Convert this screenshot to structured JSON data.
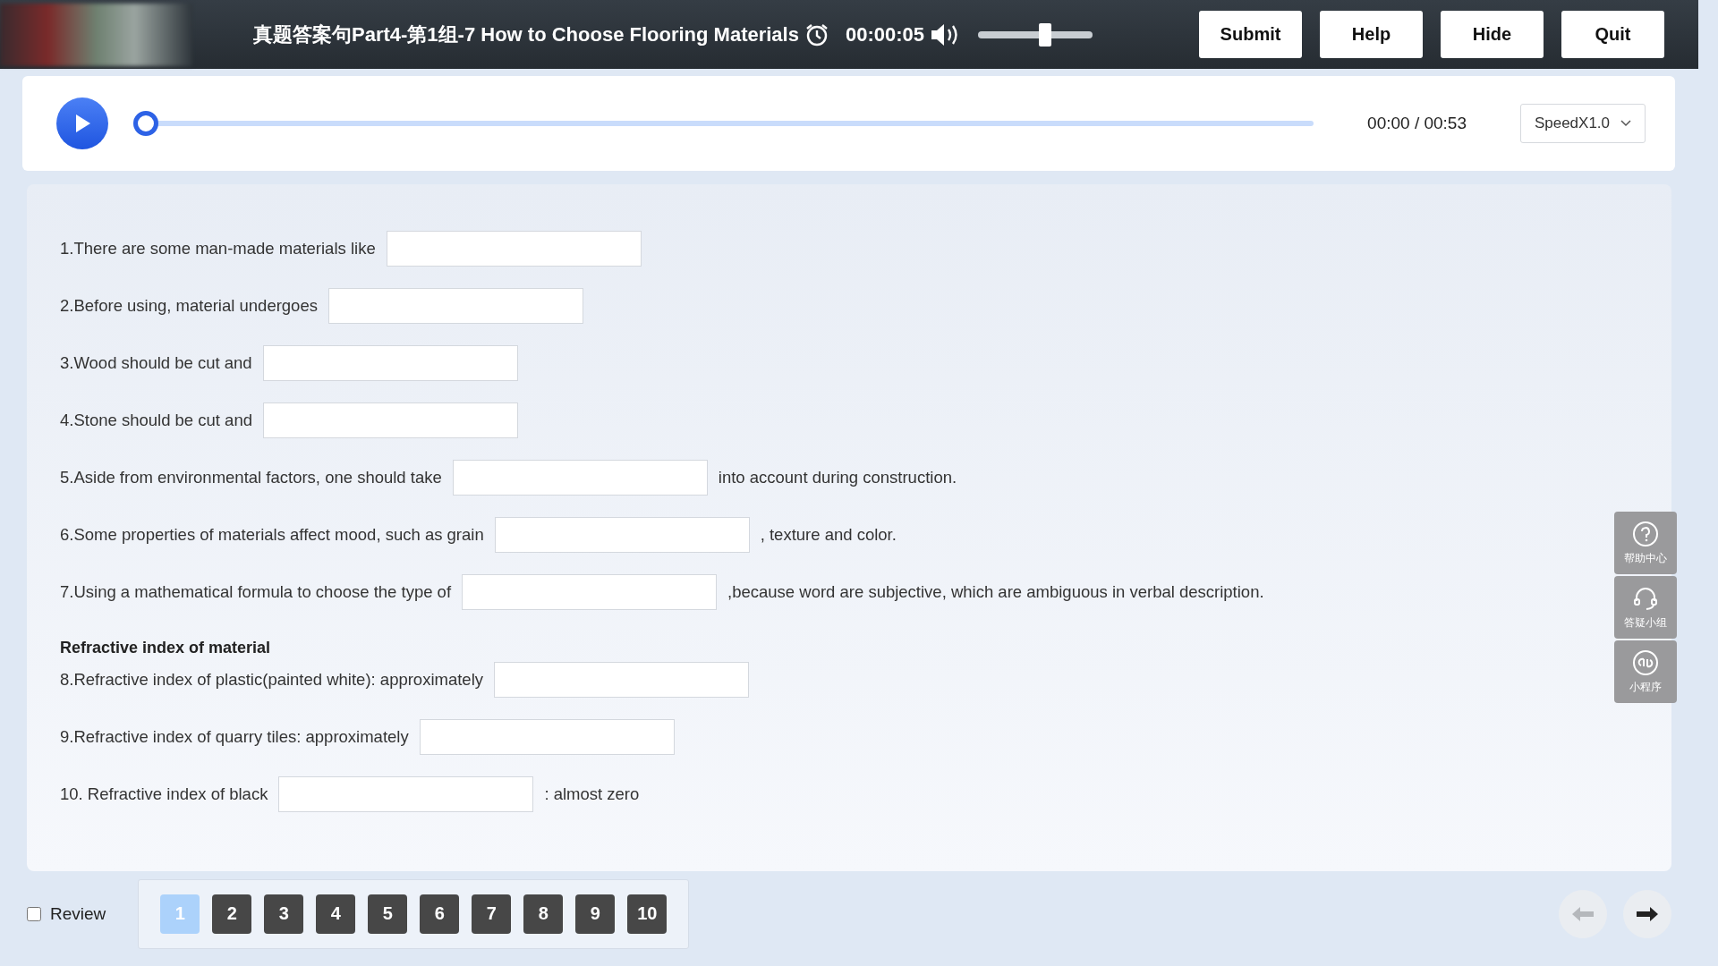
{
  "header": {
    "title": "真题答案句Part4-第1组-7 How to Choose Flooring Materials",
    "timer": "00:00:05",
    "volume": {
      "level": 0.6
    },
    "buttons": [
      "Submit",
      "Help",
      "Hide",
      "Quit"
    ]
  },
  "player": {
    "progress": {
      "level": 0
    },
    "time": "00:00 / 00:53",
    "speed": "SpeedX1.0"
  },
  "questions": [
    {
      "kind": "question",
      "before": "1.There are some man-made materials like"
    },
    {
      "kind": "question",
      "before": "2.Before using, material undergoes"
    },
    {
      "kind": "question",
      "before": "3.Wood should be cut and"
    },
    {
      "kind": "question",
      "before": "4.Stone should be cut and"
    },
    {
      "kind": "question",
      "before": "5.Aside from environmental factors, one should take",
      "after": "into account during construction."
    },
    {
      "kind": "question",
      "before": "6.Some properties of materials affect mood, such as grain",
      "after": ", texture and color."
    },
    {
      "kind": "question",
      "before": "7.Using a mathematical formula to choose the type of",
      "after": ",because word are subjective, which are ambiguous in verbal description."
    },
    {
      "kind": "heading",
      "before": "Refractive index of material"
    },
    {
      "kind": "question",
      "before": "8.Refractive index of plastic(painted white):  approximately"
    },
    {
      "kind": "question",
      "before": "9.Refractive index of quarry tiles: approximately"
    },
    {
      "kind": "question",
      "before": "10. Refractive index of black",
      "after": ": almost zero"
    }
  ],
  "side_tools": [
    {
      "kind": "help",
      "label": "帮助中心"
    },
    {
      "kind": "support",
      "label": "答疑小组"
    },
    {
      "kind": "miniapp",
      "label": "小程序"
    }
  ],
  "footer": {
    "review": {
      "label": "Review",
      "checked": false
    },
    "pages": [
      {
        "label": "1",
        "selected": true
      },
      {
        "label": "2",
        "selected": false
      },
      {
        "label": "3",
        "selected": false
      },
      {
        "label": "4",
        "selected": false
      },
      {
        "label": "5",
        "selected": false
      },
      {
        "label": "6",
        "selected": false
      },
      {
        "label": "7",
        "selected": false
      },
      {
        "label": "8",
        "selected": false
      },
      {
        "label": "9",
        "selected": false
      },
      {
        "label": "10",
        "selected": false
      }
    ],
    "prev": {
      "disabled": true
    },
    "next": {
      "disabled": false
    }
  }
}
